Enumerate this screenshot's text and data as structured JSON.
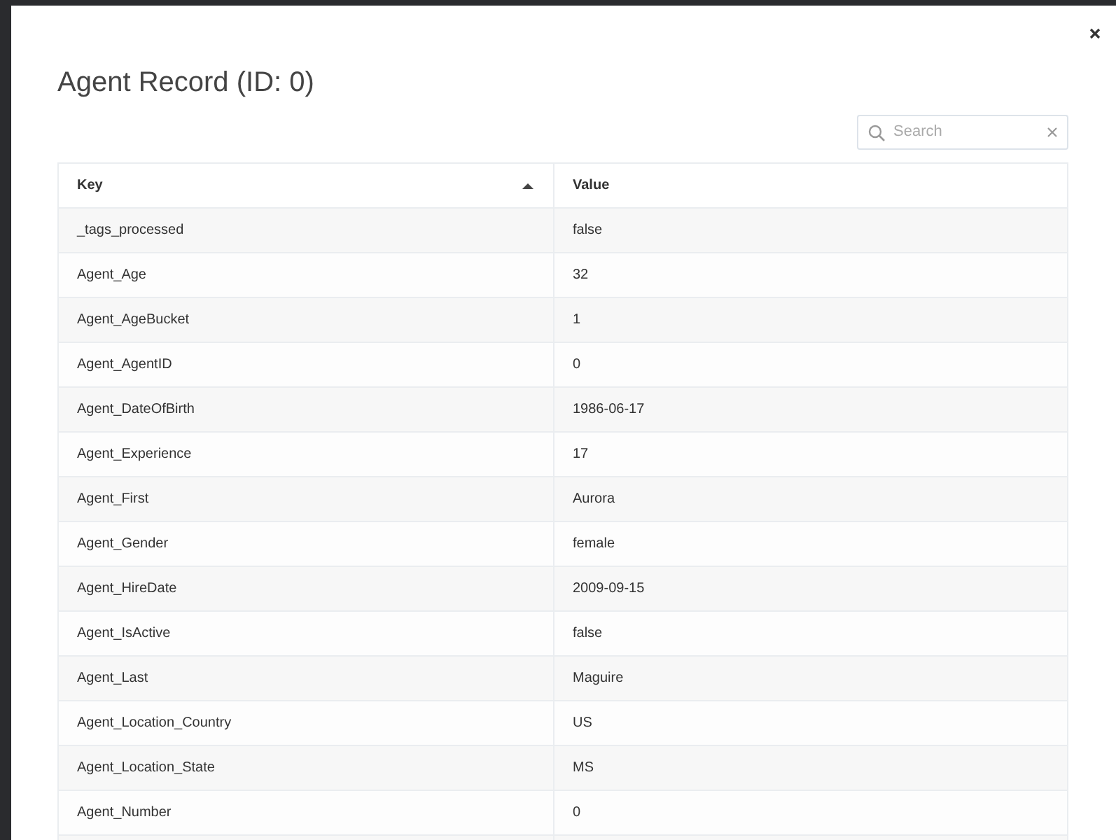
{
  "dialog": {
    "title": "Agent Record (ID: 0)"
  },
  "search": {
    "placeholder": "Search"
  },
  "table": {
    "columns": [
      {
        "label": "Key",
        "sorted": true
      },
      {
        "label": "Value",
        "sorted": false
      }
    ],
    "rows": [
      [
        "_tags_processed",
        "false"
      ],
      [
        "Agent_Age",
        "32"
      ],
      [
        "Agent_AgeBucket",
        "1"
      ],
      [
        "Agent_AgentID",
        "0"
      ],
      [
        "Agent_DateOfBirth",
        "1986-06-17"
      ],
      [
        "Agent_Experience",
        "17"
      ],
      [
        "Agent_First",
        "Aurora"
      ],
      [
        "Agent_Gender",
        "female"
      ],
      [
        "Agent_HireDate",
        "2009-09-15"
      ],
      [
        "Agent_IsActive",
        "false"
      ],
      [
        "Agent_Last",
        "Maguire"
      ],
      [
        "Agent_Location_Country",
        "US"
      ],
      [
        "Agent_Location_State",
        "MS"
      ],
      [
        "Agent_Number",
        "0"
      ]
    ]
  }
}
